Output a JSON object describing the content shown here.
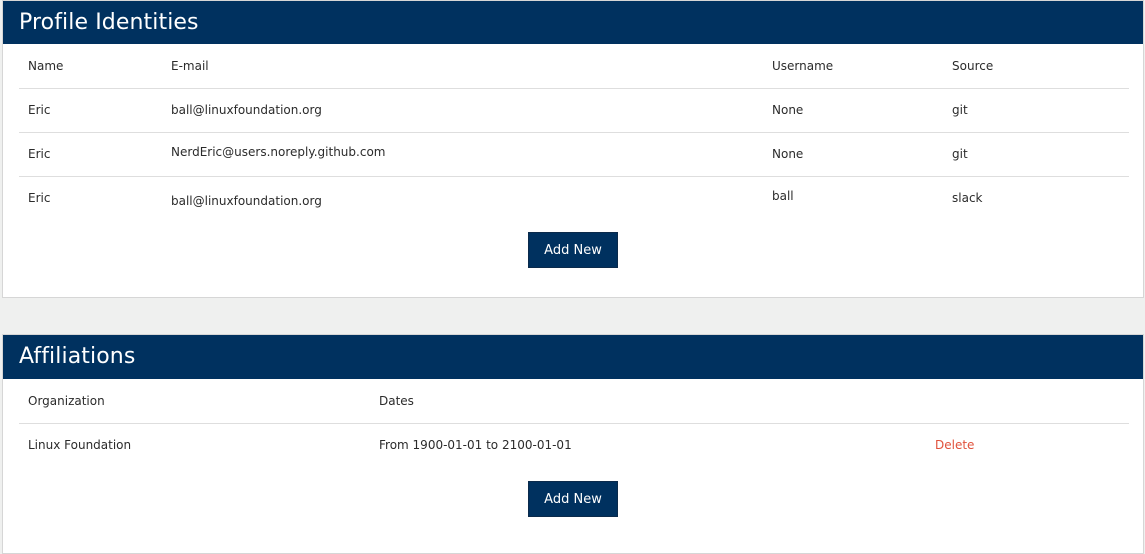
{
  "identities": {
    "title": "Profile Identities",
    "columns": [
      "Name",
      "E-mail",
      "Username",
      "Source"
    ],
    "rows": [
      {
        "name": "Eric",
        "email": "ball@linuxfoundation.org",
        "username": "None",
        "source": "git"
      },
      {
        "name": "Eric",
        "email": "NerdEric@users.noreply.github.com",
        "username": "None",
        "source": "git"
      },
      {
        "name": "Eric",
        "email": "ball@linuxfoundation.org",
        "username": "ball",
        "source": "slack"
      }
    ],
    "add_label": "Add New"
  },
  "affiliations": {
    "title": "Affiliations",
    "columns": [
      "Organization",
      "Dates"
    ],
    "rows": [
      {
        "organization": "Linux Foundation",
        "dates": "From 1900-01-01 to 2100-01-01",
        "delete_label": "Delete"
      }
    ],
    "add_label": "Add New"
  },
  "colors": {
    "header_bg": "#00315f",
    "page_bg": "#eff0ef",
    "delete_link": "#e0513b"
  }
}
